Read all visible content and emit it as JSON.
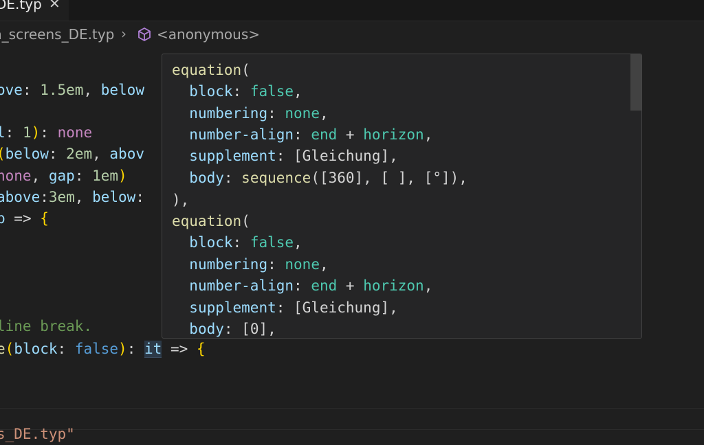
{
  "tab": {
    "label": "DE.typ",
    "close_glyph": "✕"
  },
  "breadcrumb": {
    "file": "n_screens_DE.typ",
    "separator": "›",
    "symbol": "<anonymous>"
  },
  "code": {
    "line1": {
      "a": "ove",
      "b": ": ",
      "c": "1.5em",
      "d": ", ",
      "e": "below"
    },
    "line2": {
      "a": "l",
      "b": ": ",
      "c": "1",
      "d": ")",
      "e": ": ",
      "f": "none"
    },
    "line3": {
      "a": "(",
      "b": "below",
      "c": ": ",
      "d": "2em",
      "e": ", ",
      "f": "abov"
    },
    "line4": {
      "a": "none",
      "b": ", ",
      "c": "gap",
      "d": ": ",
      "e": "1em",
      "f": ")"
    },
    "line5": {
      "a": "above",
      "b": ":",
      "c": "3em",
      "d": ", ",
      "e": "below",
      "f": ":"
    },
    "line6": {
      "a": "p",
      "b": " => ",
      "c": "{"
    },
    "line7": {
      "a": "line break."
    },
    "line8": {
      "a": "e",
      "b": "(",
      "c": "block",
      "d": ": ",
      "e": "false",
      "f": ")",
      "g": ": ",
      "h": "it",
      "i": " => ",
      "j": "{"
    },
    "line9": {
      "a": "s_DE.typ\""
    }
  },
  "hover": {
    "l1": {
      "fn": "equation",
      "p": "("
    },
    "l2": {
      "k": "block",
      "s": ": ",
      "v": "false",
      "e": ","
    },
    "l3": {
      "k": "numbering",
      "s": ": ",
      "v": "none",
      "e": ","
    },
    "l4": {
      "k": "number-align",
      "s": ": ",
      "v": "end",
      "op": " + ",
      "v2": "horizon",
      "e": ","
    },
    "l5": {
      "k": "supplement",
      "s": ": ",
      "v": "[Gleichung]",
      "e": ","
    },
    "l6": {
      "k": "body",
      "s": ": ",
      "fn": "sequence",
      "rest": "([360], [ ], [°]),"
    },
    "l7": {
      "t": "),"
    },
    "l8": {
      "fn": "equation",
      "p": "("
    },
    "l9": {
      "k": "block",
      "s": ": ",
      "v": "false",
      "e": ","
    },
    "l10": {
      "k": "numbering",
      "s": ": ",
      "v": "none",
      "e": ","
    },
    "l11": {
      "k": "number-align",
      "s": ": ",
      "v": "end",
      "op": " + ",
      "v2": "horizon",
      "e": ","
    },
    "l12": {
      "k": "supplement",
      "s": ": ",
      "v": "[Gleichung]",
      "e": ","
    },
    "l13": {
      "k": "body",
      "s": ": ",
      "v": "[0]",
      "e": ","
    }
  },
  "icons": {
    "breadcrumb_symbol": "cube-icon",
    "tab_close": "close-icon"
  },
  "colors": {
    "background": "#1f1f1f",
    "hover_background": "#252526",
    "property": "#9cdcfe",
    "number": "#b5cea8",
    "keyword": "#c586c0",
    "constant": "#4ec9b0",
    "function": "#dcdcaa",
    "comment": "#6a9955",
    "string": "#ce9178",
    "brace": "#ffd700"
  }
}
